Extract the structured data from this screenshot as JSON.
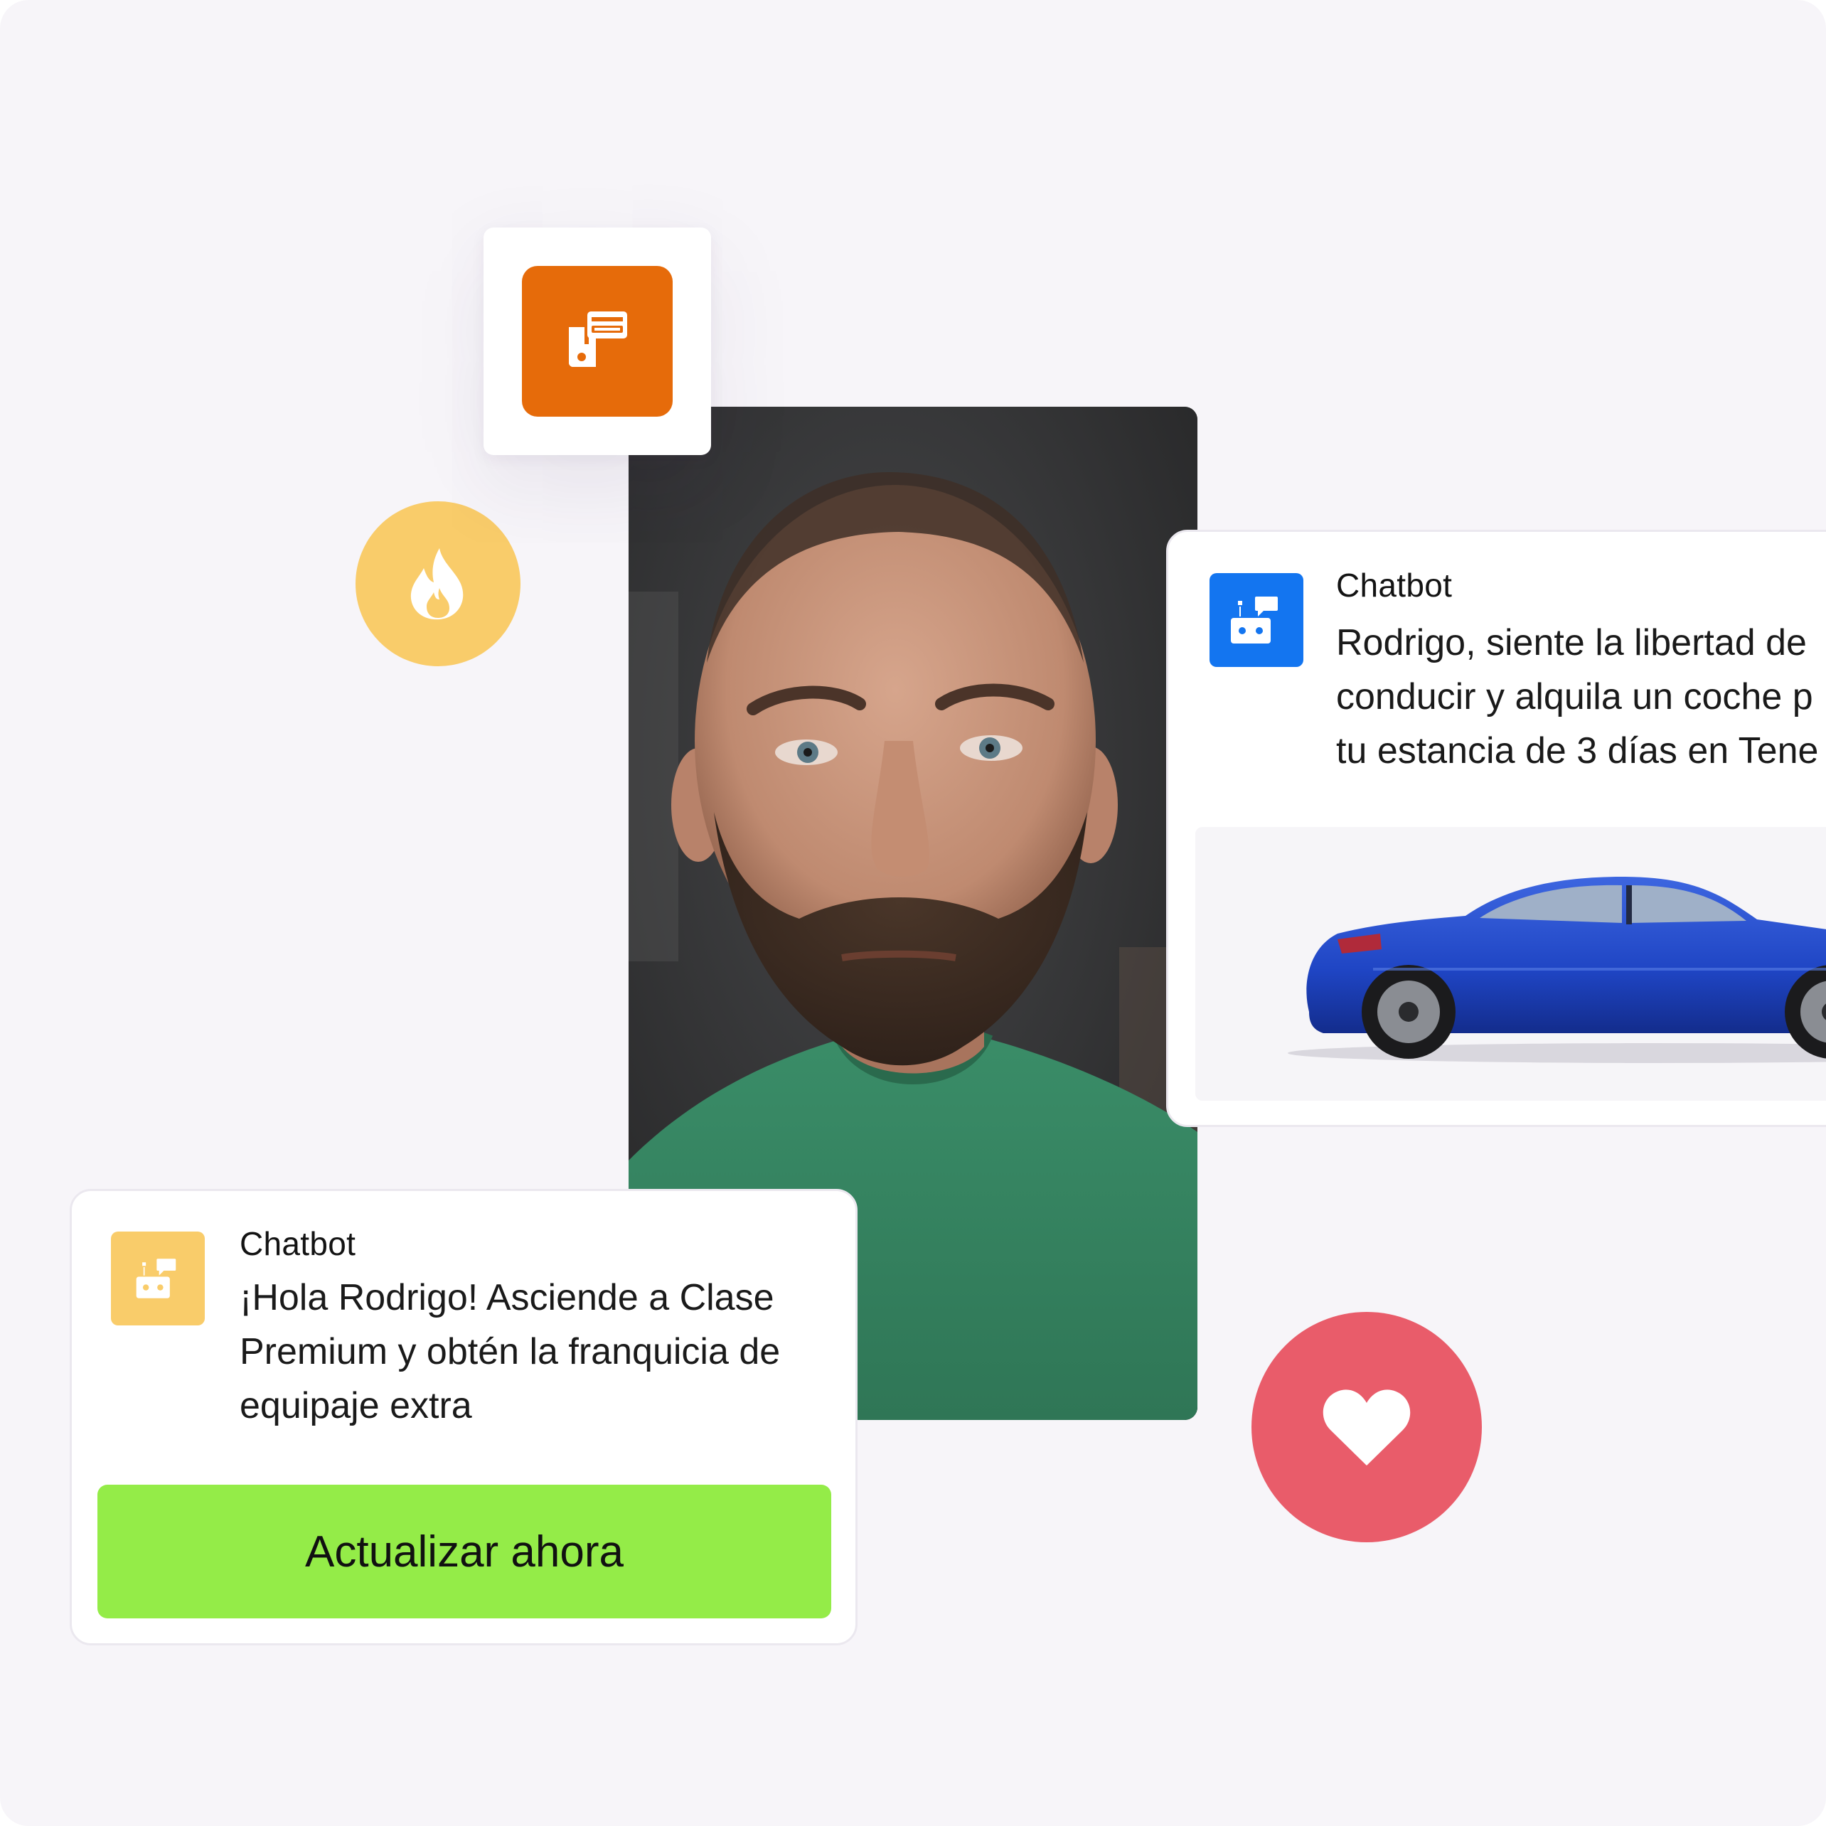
{
  "icons": {
    "device_tile": "card-reader-icon",
    "flame": "flame-icon",
    "heart": "heart-icon",
    "bot": "chatbot-icon"
  },
  "colors": {
    "background": "#f7f5f9",
    "orange_tile": "#e66b0a",
    "flame_bubble": "#f9cc6a",
    "heart_bubble": "#e95c6a",
    "bot_blue": "#1375f0",
    "bot_yellow": "#f9cc6a",
    "cta_green": "#94ec48",
    "car_blue": "#1f45c4"
  },
  "right_card": {
    "title": "Chatbot",
    "message_lines": [
      "Rodrigo, siente la libertad de",
      "conducir y alquila un coche p",
      "tu estancia de 3 días en Tene"
    ]
  },
  "left_card": {
    "title": "Chatbot",
    "message_lines": [
      "¡Hola Rodrigo! Asciende a Clase",
      "Premium y obtén la franquicia de",
      "equipaje extra"
    ],
    "cta_label": "Actualizar ahora"
  }
}
